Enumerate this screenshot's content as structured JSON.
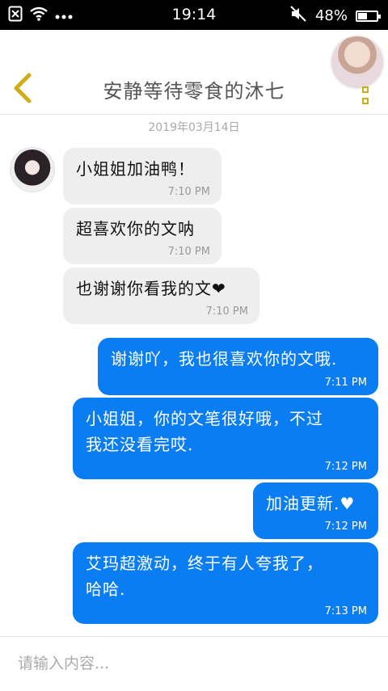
{
  "status_bar": {
    "time": "19:14",
    "battery_percent": "48%",
    "battery_level": 0.48,
    "icons": [
      "sim-missing-icon",
      "wifi-icon",
      "more-dots-icon",
      "mute-icon",
      "battery-icon"
    ]
  },
  "header": {
    "title": "安静等待零食的沐七",
    "back_icon": "chevron-left-icon",
    "menu_icon": "vertical-menu-icon",
    "accent_color": "#d0ab1b"
  },
  "chat": {
    "date": "2019年03月14日",
    "incoming_color": "#eeeeee",
    "outgoing_color": "#0a7df2",
    "messages": [
      {
        "direction": "in",
        "text": "小姐姐加油鸭！",
        "time": "7:10 PM"
      },
      {
        "direction": "in",
        "text": "超喜欢你的文呐",
        "time": "7:10 PM"
      },
      {
        "direction": "in",
        "text": "也谢谢你看我的文❤",
        "time": "7:10 PM"
      },
      {
        "direction": "out",
        "text": "谢谢吖，我也很喜欢你的文哦.",
        "time": "7:11 PM"
      },
      {
        "direction": "out",
        "text": "小姐姐，你的文笔很好哦，不过\n我还没看完哎.",
        "time": "7:12 PM"
      },
      {
        "direction": "out",
        "text": "加油更新.♥",
        "time": "7:12 PM"
      },
      {
        "direction": "out",
        "text": "艾玛超激动，终于有人夸我了，\n哈哈.",
        "time": "7:13 PM"
      }
    ]
  },
  "input": {
    "placeholder": "请输入内容...",
    "value": ""
  }
}
